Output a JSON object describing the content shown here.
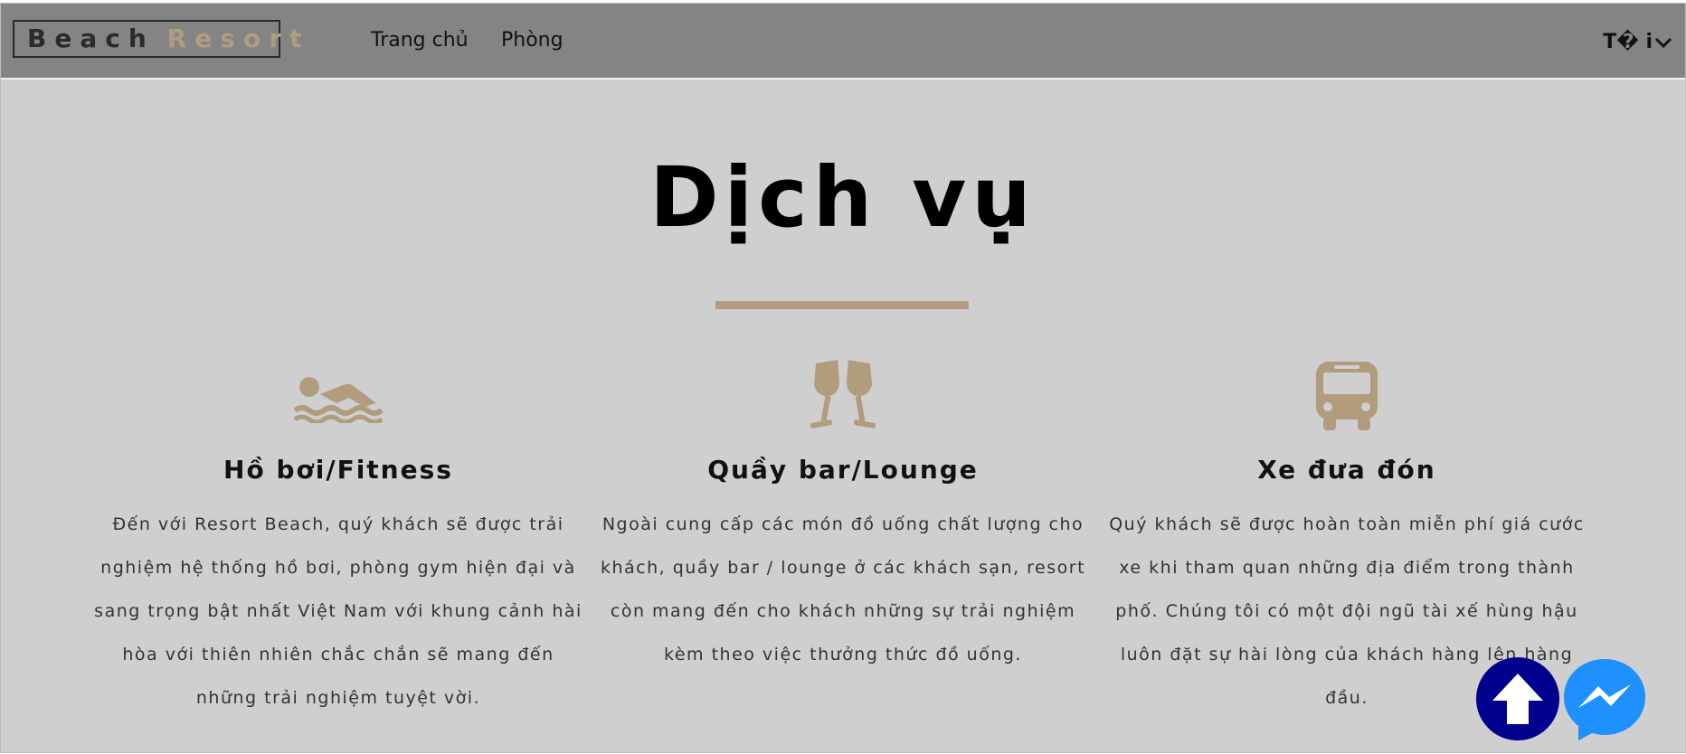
{
  "brand": {
    "word1": "Beach",
    "word2": "Resort"
  },
  "nav": {
    "items": [
      {
        "label": "Trang chủ"
      },
      {
        "label": "Phòng"
      }
    ]
  },
  "user_menu": {
    "label": "T� i"
  },
  "section": {
    "title": "Dịch vụ"
  },
  "services": [
    {
      "icon": "swimmer-icon",
      "title": "Hồ bơi/Fitness",
      "text": "Đến với Resort Beach, quý khách sẽ được trải nghiệm hệ thống hồ bơi, phòng gym hiện đại và sang trọng bật nhất Việt Nam với khung cảnh hài hòa với thiên nhiên chắc chắn sẽ mang đến những trải nghiệm tuyệt vời."
    },
    {
      "icon": "wine-glasses-icon",
      "title": "Quầy bar/Lounge",
      "text": "Ngoài cung cấp các món đồ uống chất lượng cho khách, quầy bar / lounge ở các khách sạn, resort còn mang đến cho khách những sự trải nghiệm kèm theo việc thưởng thức đồ uống."
    },
    {
      "icon": "bus-icon",
      "title": "Xe đưa đón",
      "text": "Quý khách sẽ được hoàn toàn miễn phí giá cước xe khi tham quan những địa điểm trong thành phố. Chúng tôi có một đội ngũ tài xế hùng hậu luôn đặt sự hài lòng của khách hàng lên hàng đầu."
    }
  ],
  "colors": {
    "accent": "#b19c7e",
    "navbar": "#848484",
    "background": "#cfcfcf",
    "scroll_top_button": "#00008f",
    "messenger": "#1e90ff"
  }
}
